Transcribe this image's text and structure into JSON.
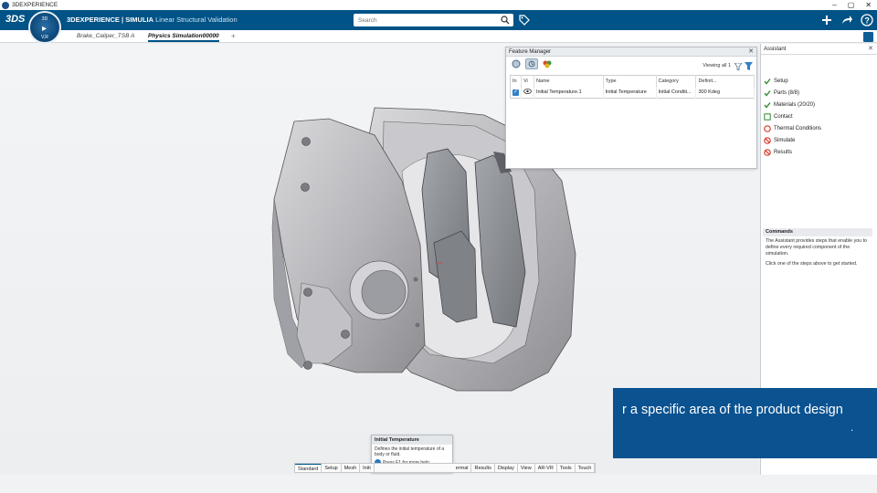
{
  "window": {
    "title": "3DEXPERIENCE",
    "controls": [
      "–",
      "▢",
      "✕"
    ]
  },
  "topbar": {
    "logo": "3DS",
    "brand": "3DEXPERIENCE | SIMULIA",
    "app_name": "Linear Structural Validation",
    "compass_top": "3D",
    "compass_bottom": "V,R",
    "search_placeholder": "Search",
    "right_icons": [
      "add-icon",
      "share-icon",
      "help-icon"
    ]
  },
  "tabs": [
    {
      "label": "Brake_Caliper_TSB A",
      "active": false
    },
    {
      "label": "Physics Simulation00000",
      "active": true
    }
  ],
  "feature_manager": {
    "title": "Feature Manager",
    "viewing": "Viewing all 1",
    "columns": [
      "In",
      "Vi",
      "Name",
      "Type",
      "Category",
      "Definit..."
    ],
    "rows": [
      {
        "in": "✓",
        "vi": "eye-icon",
        "name": "Initial Temperature.1",
        "type": "Initial Temperature",
        "category": "Initial Conditi...",
        "definition": "300 Kdeg"
      }
    ]
  },
  "assistant": {
    "title": "Assistant",
    "steps": [
      {
        "label": "Setup",
        "status": "done"
      },
      {
        "label": "Parts (8/8)",
        "status": "done"
      },
      {
        "label": "Materials (20/20)",
        "status": "done"
      },
      {
        "label": "Contact",
        "status": "open"
      },
      {
        "label": "Thermal Conditions",
        "status": "warning"
      },
      {
        "label": "Simulate",
        "status": "blocked"
      },
      {
        "label": "Results",
        "status": "blocked"
      }
    ],
    "commands_title": "Commands",
    "commands_text_1": "The Assistant provides steps that enable you to define every required component of the simulation.",
    "commands_text_2": "Click one of the steps above to get started."
  },
  "tooltip": {
    "title": "Initial Temperature",
    "body": "Defines the initial temperature of a body or fluid.",
    "help": "Press F1 for more help."
  },
  "action_bar": {
    "tabs": [
      "Standard",
      "Setup",
      "Mesh",
      "Initi",
      "",
      "ermal",
      "Results",
      "Display",
      "View",
      "AR-VR",
      "Tools",
      "Touch"
    ],
    "active": "Standard"
  },
  "caption": {
    "text": "r a specific area of the product design",
    "dot": "."
  },
  "colors": {
    "topbar": "#005386",
    "caption_bg": "#0a5290",
    "check_green": "#2e8b2e",
    "warning_red": "#d9382b"
  }
}
